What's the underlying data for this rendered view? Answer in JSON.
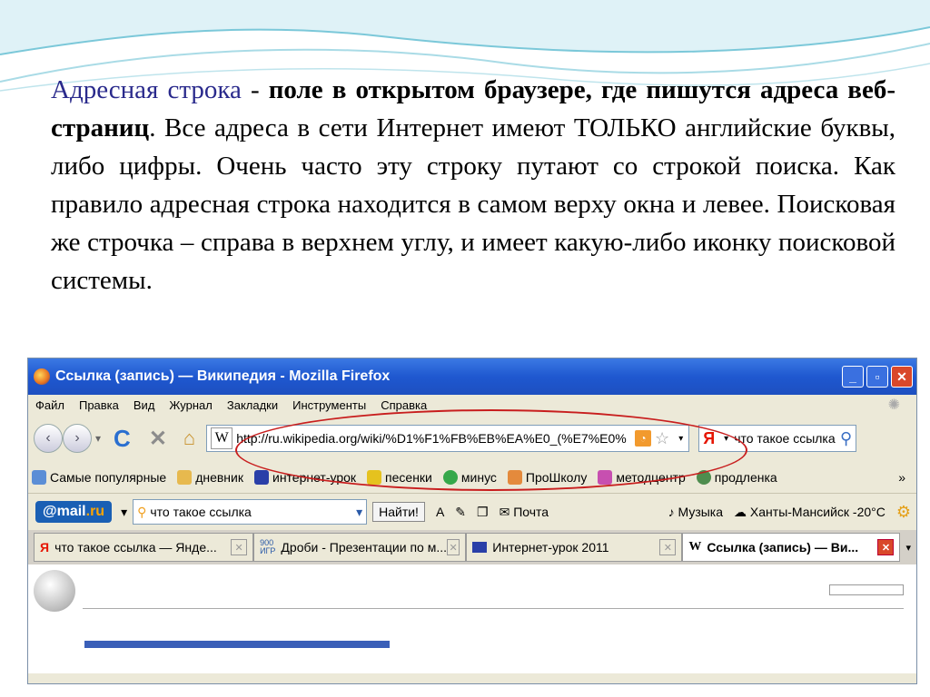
{
  "slide": {
    "term": "Адресная строка",
    "dash": " - ",
    "bold_def": "поле в открытом браузере, где пишутся адреса веб-страниц",
    "rest": ". Все адреса в сети Интернет имеют ТОЛЬКО английские буквы, либо цифры. Очень часто эту строку путают со строкой поиска. Как правило адресная строка находится в самом верху окна и левее. Поисковая же строчка – справа в верхнем углу, и имеет какую-либо иконку поисковой системы."
  },
  "browser": {
    "title": "Ссылка (запись) — Википедия - Mozilla Firefox",
    "menu": [
      "Файл",
      "Правка",
      "Вид",
      "Журнал",
      "Закладки",
      "Инструменты",
      "Справка"
    ],
    "url": "http://ru.wikipedia.org/wiki/%D1%F1%FB%EB%EA%E0_(%E7%E0%",
    "search_value": "что такое ссылка",
    "bookmarks": [
      "Самые популярные",
      "дневник",
      "интернет-урок",
      "песенки",
      "минус",
      "ПроШколу",
      "методцентр",
      "продленка"
    ],
    "mailbar": {
      "logo_pre": "@mail",
      "logo_post": ".ru",
      "search_value": "что такое ссылка",
      "go_label": "Найти!",
      "mail_label": "Почта",
      "music_label": "Музыка",
      "weather_label": "Ханты-Мансийск -20°C"
    },
    "tabs": [
      {
        "label": "что такое ссылка — Янде..."
      },
      {
        "label": "Дроби - Презентации по м..."
      },
      {
        "label": "Интернет-урок 2011"
      },
      {
        "label": "Ссылка (запись) — Ви..."
      }
    ]
  },
  "colors": {
    "accent_title": "#2a2a8c",
    "ellipse": "#c81e1e",
    "titlebar": "#1f58d0"
  }
}
